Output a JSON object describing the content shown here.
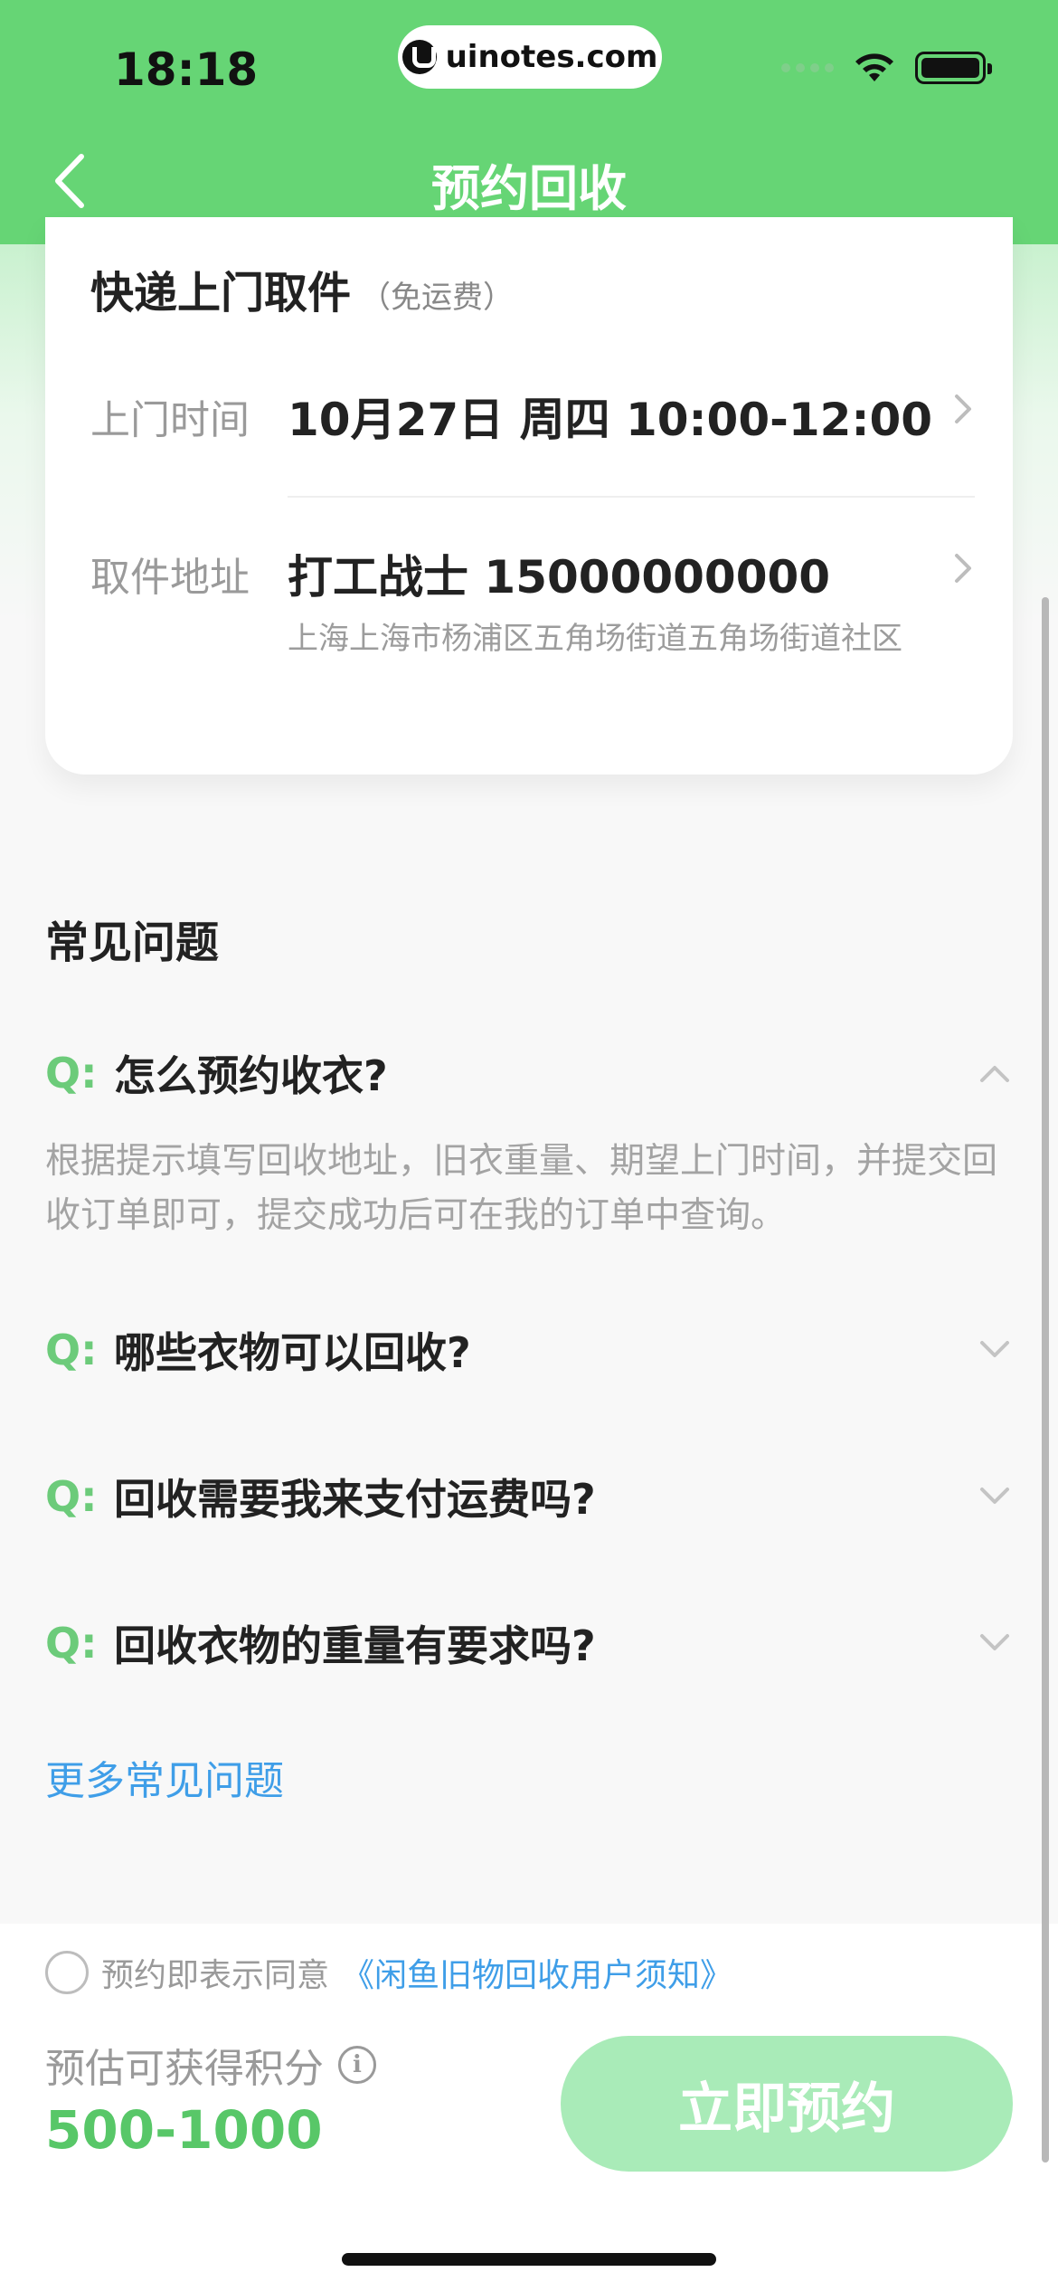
{
  "status_bar": {
    "time": "18:18",
    "url": "uinotes.com",
    "icons": [
      "signal-icon",
      "wifi-icon",
      "battery-icon"
    ]
  },
  "nav": {
    "title": "预约回收",
    "back_icon": "chevron-left-icon"
  },
  "pickup_card": {
    "title": "快递上门取件",
    "title_note": "（免运费）",
    "time_label": "上门时间",
    "time_value": "10月27日 周四 10:00-12:00",
    "address_label": "取件地址",
    "address_contact": "打工战士 15000000000",
    "address_detail": "上海上海市杨浦区五角场街道五角场街道社区"
  },
  "faq": {
    "title": "常见问题",
    "prefix": "Q:",
    "items": [
      {
        "question": "怎么预约收衣?",
        "answer": "根据提示填写回收地址，旧衣重量、期望上门时间，并提交回收订单即可，提交成功后可在我的订单中查询。",
        "expanded": true
      },
      {
        "question": "哪些衣物可以回收?",
        "answer": "",
        "expanded": false
      },
      {
        "question": "回收需要我来支付运费吗?",
        "answer": "",
        "expanded": false
      },
      {
        "question": "回收衣物的重量有要求吗?",
        "answer": "",
        "expanded": false
      }
    ],
    "more_link": "更多常见问题"
  },
  "bottom_bar": {
    "agreement_text": "预约即表示同意",
    "agreement_link": "《闲鱼旧物回收用户须知》",
    "points_label": "预估可获得积分",
    "points_value": "500-1000",
    "submit_label": "立即预约"
  },
  "colors": {
    "header_green": "#66d575",
    "accent_green": "#58c768",
    "link_blue": "#3f9ee8",
    "button_disabled": "#a9ebb8"
  }
}
